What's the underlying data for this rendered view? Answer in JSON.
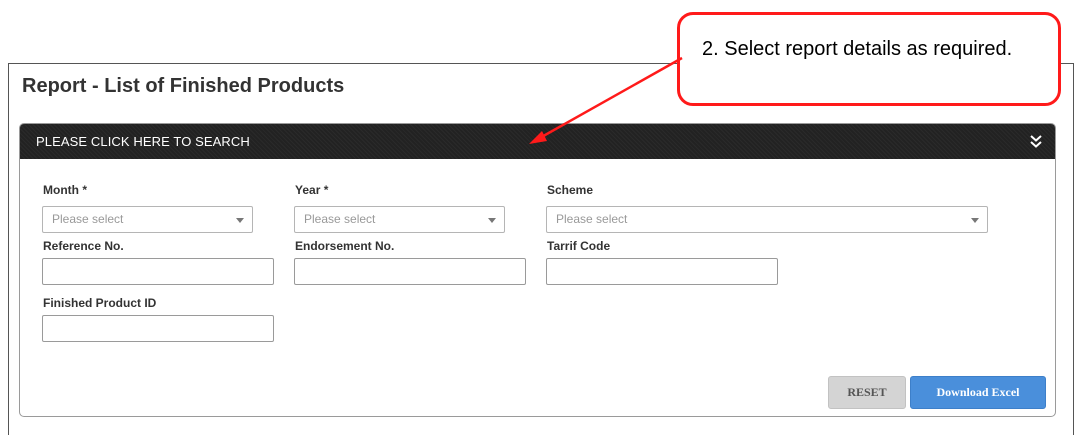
{
  "page": {
    "title": "Report - List of Finished Products"
  },
  "search_panel": {
    "header_label": "PLEASE CLICK HERE TO SEARCH",
    "toggle_icon": "double-chevron-down-icon"
  },
  "form": {
    "month": {
      "label": "Month *",
      "value": "Please select"
    },
    "year": {
      "label": "Year *",
      "value": "Please select"
    },
    "scheme": {
      "label": "Scheme",
      "value": "Please select"
    },
    "reference_no": {
      "label": "Reference No.",
      "value": ""
    },
    "endorsement_no": {
      "label": "Endorsement No.",
      "value": ""
    },
    "tarrif_code": {
      "label": "Tarrif Code",
      "value": ""
    },
    "finished_product_id": {
      "label": "Finished Product ID",
      "value": ""
    }
  },
  "buttons": {
    "reset_label": "RESET",
    "download_label": "Download Excel"
  },
  "annotation": {
    "text": "2. Select report details as required.",
    "color": "#ff1a1a"
  },
  "colors": {
    "header_bg": "#222222",
    "download_button": "#4a8fdb",
    "reset_button": "#d4d4d4"
  }
}
